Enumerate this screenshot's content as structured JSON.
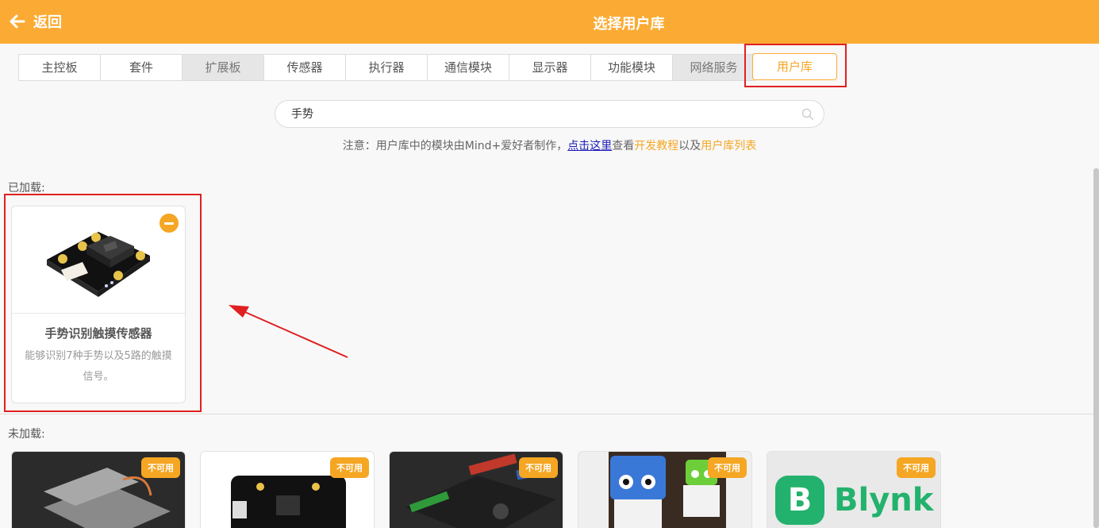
{
  "header": {
    "back_label": "返回",
    "title": "选择用户库"
  },
  "tabs": [
    {
      "label": "主控板"
    },
    {
      "label": "套件"
    },
    {
      "label": "扩展板"
    },
    {
      "label": "传感器"
    },
    {
      "label": "执行器"
    },
    {
      "label": "通信模块"
    },
    {
      "label": "显示器"
    },
    {
      "label": "功能模块"
    },
    {
      "label": "网络服务"
    }
  ],
  "active_tab": {
    "label": "用户库"
  },
  "search": {
    "value": "手势"
  },
  "notice": {
    "prefix": "注意：用户库中的模块由Mind+爱好者制作，",
    "link": "点击这里",
    "middle": "查看",
    "tutorial": "开发教程",
    "and": "以及",
    "list": "用户库列表"
  },
  "loaded": {
    "label": "已加载:",
    "items": [
      {
        "name": "手势识别触摸传感器",
        "desc": "能够识别7种手势以及5路的触摸信号。"
      }
    ]
  },
  "unloaded": {
    "label": "未加载:",
    "badge": "不可用",
    "blynk_text": "Blynk"
  },
  "colors": {
    "accent": "#fbab34",
    "highlight": "#e02020"
  }
}
